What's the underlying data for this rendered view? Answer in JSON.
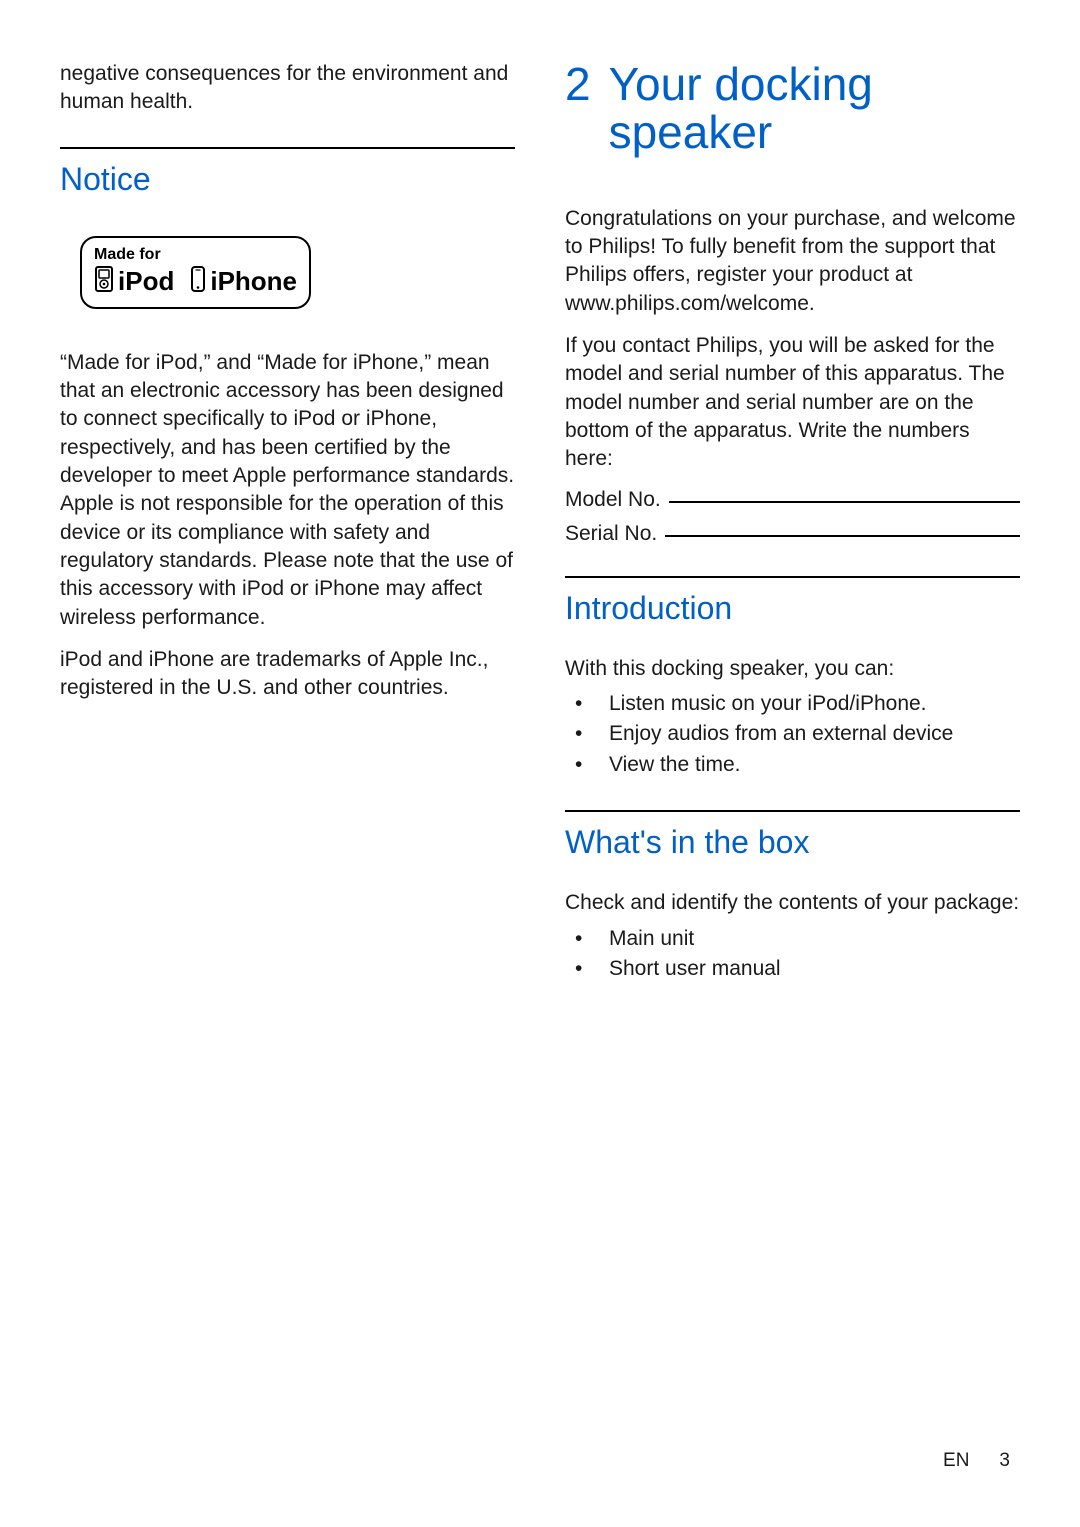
{
  "left": {
    "intro_fragment": "negative consequences for the environment and human health.",
    "notice_heading": "Notice",
    "mfi": {
      "made_for": "Made for",
      "ipod": "iPod",
      "iphone": "iPhone"
    },
    "mfi_para": "“Made for iPod,” and “Made for iPhone,” mean that an electronic accessory has been designed to connect specifically to iPod or iPhone, respectively, and has been certified by the developer to meet Apple performance standards. Apple is not responsible for the operation of this device or its compliance with safety and regulatory standards. Please note that the use of this accessory with iPod or iPhone may affect wireless performance.",
    "trademark_para": "iPod and iPhone are trademarks of Apple Inc., registered in the U.S. and other countries."
  },
  "right": {
    "chapter_number": "2",
    "chapter_title": "Your docking speaker",
    "congrats_para": "Congratulations on your purchase, and welcome to Philips! To fully benefit from the support that Philips offers, register your product at www.philips.com/welcome.",
    "contact_para": "If you contact Philips, you will be asked for the model and serial number of this apparatus. The model number and serial number are on the bottom of the apparatus. Write the numbers here:",
    "model_label": "Model No.",
    "serial_label": "Serial No.",
    "intro_heading": "Introduction",
    "intro_lead": "With this docking speaker, you can:",
    "intro_bullets": [
      "Listen music on your iPod/iPhone.",
      "Enjoy audios from an external device",
      "View the time."
    ],
    "box_heading": "What's in the box",
    "box_lead": "Check and identify the contents of your package:",
    "box_bullets": [
      "Main unit",
      "Short user manual"
    ]
  },
  "footer": {
    "lang": "EN",
    "page": "3"
  }
}
